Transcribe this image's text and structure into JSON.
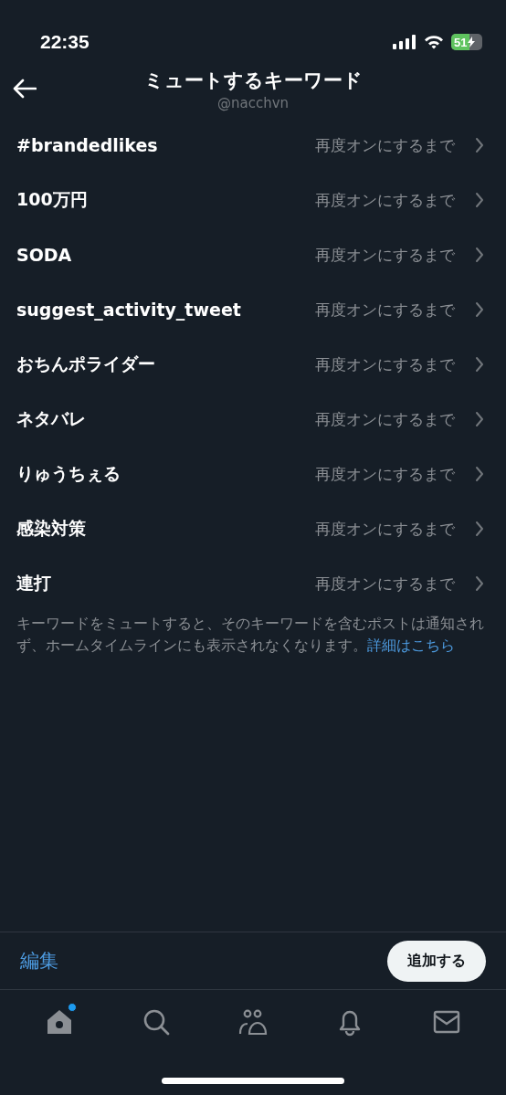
{
  "status_bar": {
    "time": "22:35",
    "battery": "51"
  },
  "header": {
    "title": "ミュートするキーワード",
    "subtitle": "@nacchvn"
  },
  "keywords": [
    {
      "keyword": "#brandedlikes",
      "duration": "再度オンにするまで"
    },
    {
      "keyword": "100万円",
      "duration": "再度オンにするまで"
    },
    {
      "keyword": "SODA",
      "duration": "再度オンにするまで"
    },
    {
      "keyword": "suggest_activity_tweet",
      "duration": "再度オンにするまで"
    },
    {
      "keyword": "おちんポライダー",
      "duration": "再度オンにするまで"
    },
    {
      "keyword": "ネタバレ",
      "duration": "再度オンにするまで"
    },
    {
      "keyword": "りゅうちぇる",
      "duration": "再度オンにするまで"
    },
    {
      "keyword": "感染対策",
      "duration": "再度オンにするまで"
    },
    {
      "keyword": "連打",
      "duration": "再度オンにするまで"
    }
  ],
  "note": {
    "text": "キーワードをミュートすると、そのキーワードを含むポストは通知されず、ホームタイムラインにも表示されなくなります。",
    "link": "詳細はこちら"
  },
  "footer": {
    "edit": "編集",
    "add": "追加する"
  },
  "tabs": [
    {
      "kind": "home",
      "selected": true,
      "badge": true
    },
    {
      "kind": "search",
      "selected": false,
      "badge": false
    },
    {
      "kind": "communities",
      "selected": false,
      "badge": false
    },
    {
      "kind": "notifications",
      "selected": false,
      "badge": false
    },
    {
      "kind": "messages",
      "selected": false,
      "badge": false
    }
  ]
}
